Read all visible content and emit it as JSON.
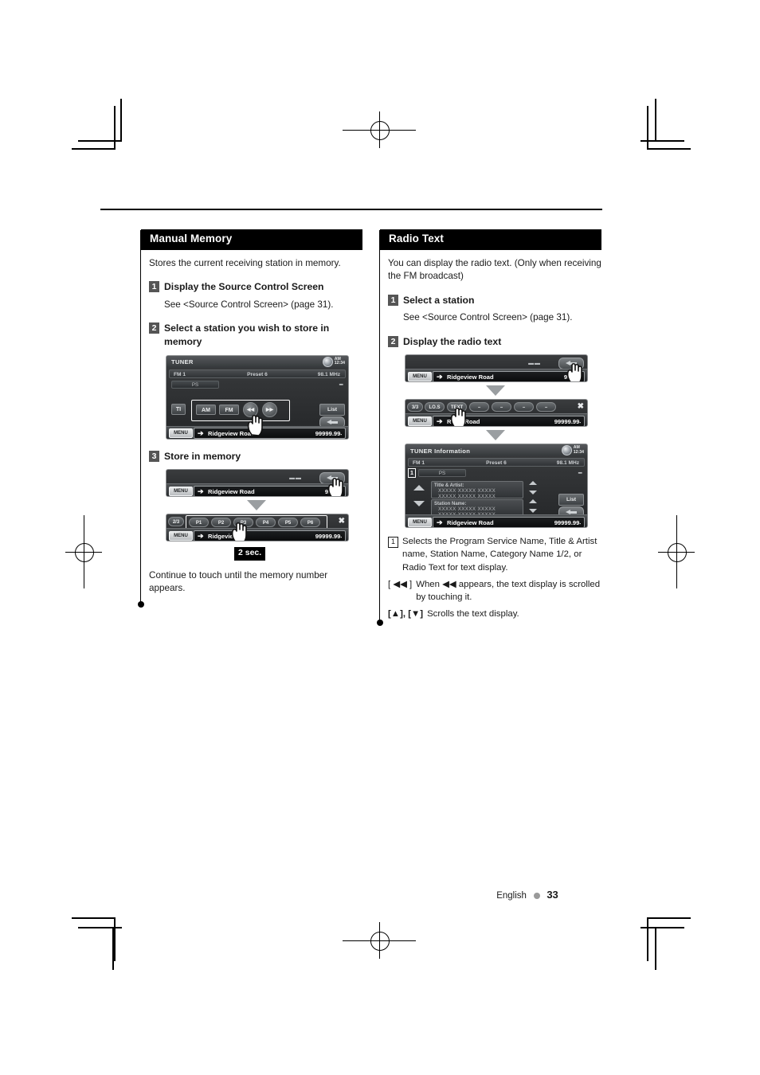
{
  "page": {
    "footer_language": "English",
    "footer_page_number": "33"
  },
  "left_column": {
    "section_title": "Manual Memory",
    "intro": "Stores the current receiving station in memory.",
    "steps": [
      {
        "num": "1",
        "title": "Display the Source Control Screen",
        "sub": "See <Source Control Screen> (page 31)."
      },
      {
        "num": "2",
        "title": "Select a station you wish to store in memory",
        "sub": ""
      },
      {
        "num": "3",
        "title": "Store in memory",
        "sub": ""
      }
    ],
    "tuner_screen": {
      "title": "TUNER",
      "clock_ampm": "AM",
      "clock_time": "12:34",
      "band": "FM  1",
      "preset": "Preset  6",
      "frequency": "98.1  MHz",
      "ps_label": "PS",
      "dots": "▪▪▪",
      "buttons": [
        "TI",
        "AM",
        "FM"
      ],
      "seek_prev": "◀◀",
      "seek_next": "▶▶",
      "list_label": "List",
      "menu_label": "MENU",
      "station_name": "Ridgeview Road",
      "station_freq": "99999.99",
      "station_freq_unit": "▪"
    },
    "store_strip_1": {
      "menu_label": "MENU",
      "station_name": "Ridgeview Road",
      "station_freq": "99999"
    },
    "store_strip_2": {
      "page_indicator": "2/3",
      "presets": [
        "P1",
        "P2",
        "P3",
        "P4",
        "P5",
        "P6"
      ],
      "close_label": "✖",
      "menu_label": "MENU",
      "station_name": "Ridgeview",
      "station_freq": "99999.99",
      "station_freq_unit": "▪"
    },
    "hold_badge": "2 sec.",
    "closing_note": "Continue to touch until the memory number appears."
  },
  "right_column": {
    "section_title": "Radio Text",
    "intro": "You can display the radio text. (Only when receiving the FM broadcast)",
    "steps": [
      {
        "num": "1",
        "title": "Select a station",
        "sub": "See <Source Control Screen> (page 31)."
      },
      {
        "num": "2",
        "title": "Display the radio text",
        "sub": ""
      }
    ],
    "strip_1": {
      "menu_label": "MENU",
      "station_name": "Ridgeview Road",
      "station_freq": "99999"
    },
    "strip_2": {
      "page_indicator": "3/3",
      "buttons": [
        "LO.S",
        "TEXT",
        "–",
        "–",
        "–",
        "–"
      ],
      "close_label": "✖",
      "menu_label": "MENU",
      "station_name": "Rid       w Road",
      "station_freq": "99999.99",
      "station_freq_unit": "▪"
    },
    "tuner_info_screen": {
      "title": "TUNER Information",
      "clock_ampm": "AM",
      "clock_time": "12:34",
      "band": "FM  1",
      "preset": "Preset  6",
      "frequency": "98.1  MHz",
      "marker": "1",
      "ps_label": "PS",
      "dots": "▪▪▪",
      "panels": [
        {
          "label": "Title & Artist:",
          "line1": "XXXXX XXXXX XXXXX",
          "line2": "XXXXX XXXXX XXXXX"
        },
        {
          "label": "Station Name:",
          "line1": "XXXXX XXXXX XXXXX",
          "line2": "XXXXX XXXXX XXXXX"
        }
      ],
      "list_label": "List",
      "menu_label": "MENU",
      "station_name": "Ridgeview Road",
      "station_freq": "99999.99",
      "station_freq_unit": "▪"
    },
    "captions": [
      {
        "key_num": "1",
        "key_sym": "",
        "text": "Selects the Program Service Name, Title & Artist name, Station Name, Category Name 1/2, or Radio Text for text display."
      },
      {
        "key_num": "",
        "key_sym": "[ ◀◀ ]",
        "text": "When ◀◀ appears, the text display is scrolled by touching it."
      },
      {
        "key_num": "",
        "key_sym": "[▲], [▼]",
        "text": "Scrolls the text display."
      }
    ]
  }
}
